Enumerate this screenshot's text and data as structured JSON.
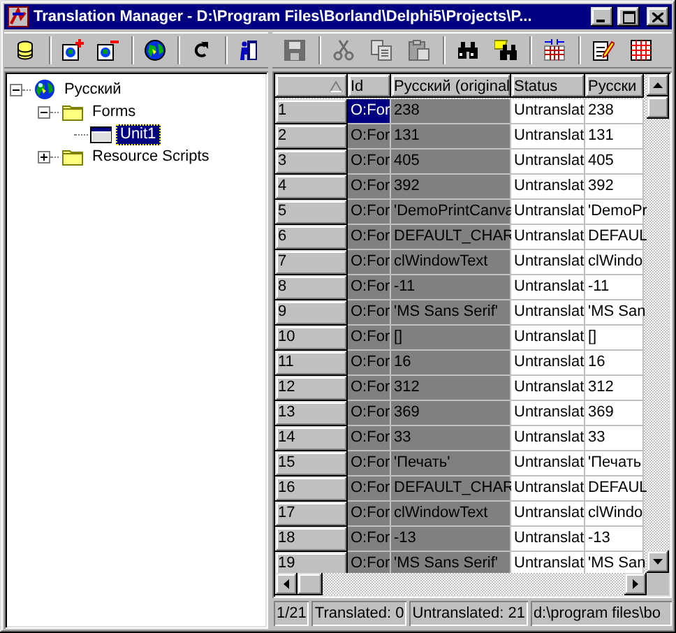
{
  "window": {
    "title": "Translation Manager - D:\\Program Files\\Borland\\Delphi5\\Projects\\P..."
  },
  "left_toolbar": [
    {
      "kind": "database"
    },
    {
      "kind": "language_add"
    },
    {
      "kind": "language_remove"
    },
    {
      "kind": "globe"
    },
    {
      "kind": "refresh"
    },
    {
      "kind": "exit"
    }
  ],
  "right_toolbar": [
    {
      "kind": "save",
      "disabled": true
    },
    {
      "kind": "cut",
      "disabled": true
    },
    {
      "kind": "copy",
      "disabled": true
    },
    {
      "kind": "paste",
      "disabled": true
    },
    {
      "kind": "find",
      "disabled": false
    },
    {
      "kind": "replace",
      "disabled": false
    },
    {
      "kind": "columns",
      "disabled": false
    },
    {
      "kind": "edit",
      "disabled": false
    },
    {
      "kind": "grid",
      "disabled": false
    }
  ],
  "tree": {
    "items": [
      {
        "label": "Русский",
        "kind": "language",
        "expanded": true,
        "selected": false,
        "children": [
          {
            "label": "Forms",
            "kind": "folder",
            "expanded": true,
            "selected": false,
            "children": [
              {
                "label": "Unit1",
                "kind": "form",
                "selected": true
              }
            ]
          },
          {
            "label": "Resource Scripts",
            "kind": "folder",
            "expanded": false,
            "selected": false
          }
        ]
      }
    ]
  },
  "grid": {
    "columns": [
      "Id",
      "Русский (original",
      "Status",
      "Русски"
    ],
    "rows": [
      {
        "number": "1",
        "id": "O:For",
        "original": "238",
        "status": "Untranslat",
        "translation": "238",
        "selected": true
      },
      {
        "number": "2",
        "id": "O:For",
        "original": "131",
        "status": "Untranslat",
        "translation": "131",
        "selected": false
      },
      {
        "number": "3",
        "id": "O:For",
        "original": "405",
        "status": "Untranslat",
        "translation": "405",
        "selected": false
      },
      {
        "number": "4",
        "id": "O:For",
        "original": "392",
        "status": "Untranslat",
        "translation": "392",
        "selected": false
      },
      {
        "number": "5",
        "id": "O:For",
        "original": "'DemoPrintCanva",
        "status": "Untranslat",
        "translation": "'DemoPr",
        "selected": false
      },
      {
        "number": "6",
        "id": "O:For",
        "original": "DEFAULT_CHAR",
        "status": "Untranslat",
        "translation": "DEFAUL",
        "selected": false
      },
      {
        "number": "7",
        "id": "O:For",
        "original": "clWindowText",
        "status": "Untranslat",
        "translation": "clWindo",
        "selected": false
      },
      {
        "number": "8",
        "id": "O:For",
        "original": "-11",
        "status": "Untranslat",
        "translation": "-11",
        "selected": false
      },
      {
        "number": "9",
        "id": "O:For",
        "original": "'MS Sans Serif'",
        "status": "Untranslat",
        "translation": "'MS San",
        "selected": false
      },
      {
        "number": "10",
        "id": "O:For",
        "original": "[]",
        "status": "Untranslat",
        "translation": "[]",
        "selected": false
      },
      {
        "number": "11",
        "id": "O:For",
        "original": "16",
        "status": "Untranslat",
        "translation": "16",
        "selected": false
      },
      {
        "number": "12",
        "id": "O:For",
        "original": "312",
        "status": "Untranslat",
        "translation": "312",
        "selected": false
      },
      {
        "number": "13",
        "id": "O:For",
        "original": "369",
        "status": "Untranslat",
        "translation": "369",
        "selected": false
      },
      {
        "number": "14",
        "id": "O:For",
        "original": "33",
        "status": "Untranslat",
        "translation": "33",
        "selected": false
      },
      {
        "number": "15",
        "id": "O:For",
        "original": "'Печать'",
        "status": "Untranslat",
        "translation": "'Печать",
        "selected": false
      },
      {
        "number": "16",
        "id": "O:For",
        "original": "DEFAULT_CHAR",
        "status": "Untranslat",
        "translation": "DEFAUL",
        "selected": false
      },
      {
        "number": "17",
        "id": "O:For",
        "original": "clWindowText",
        "status": "Untranslat",
        "translation": "clWindo",
        "selected": false
      },
      {
        "number": "18",
        "id": "O:For",
        "original": "-13",
        "status": "Untranslat",
        "translation": "-13",
        "selected": false
      },
      {
        "number": "19",
        "id": "O:For",
        "original": "'MS Sans Serif'",
        "status": "Untranslat",
        "translation": "'MS San",
        "selected": false
      }
    ]
  },
  "status_bar": [
    "1/21",
    "Translated: 0",
    "Untranslated: 21",
    "d:\\program files\\bo"
  ]
}
